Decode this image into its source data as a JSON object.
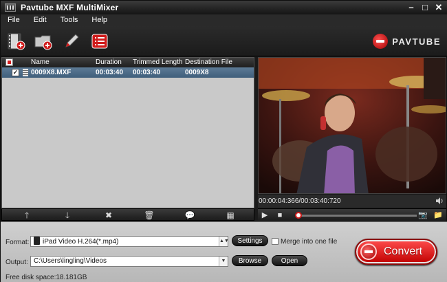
{
  "window": {
    "title": "Pavtube MXF MultiMixer"
  },
  "menu": [
    {
      "label": "File"
    },
    {
      "label": "Edit"
    },
    {
      "label": "Tools"
    },
    {
      "label": "Help"
    }
  ],
  "brand": {
    "logo_text": "PAVTUBE",
    "accent": "#d01b1b"
  },
  "toolbar_icons": [
    "add-video-icon",
    "add-folder-icon",
    "edit-pencil-icon",
    "task-list-icon"
  ],
  "file_list": {
    "columns": {
      "name": "Name",
      "duration": "Duration",
      "trimmed": "Trimmed Length",
      "destination": "Destination File"
    },
    "rows": [
      {
        "checked": true,
        "name": "0009X8.MXF",
        "duration": "00:03:40",
        "trimmed": "00:03:40",
        "destination": "0009X8"
      }
    ]
  },
  "list_tools": [
    "move-up-icon",
    "move-down-icon",
    "remove-icon",
    "delete-all-icon",
    "subtitle-icon",
    "merge-icon"
  ],
  "preview": {
    "time": "00:00:04:366/00:03:40:720",
    "seek_fraction": 0.02
  },
  "output_settings": {
    "format_label": "Format:",
    "format_value": "iPad Video H.264(*.mp4)",
    "settings_button": "Settings",
    "merge_label": "Merge into one file",
    "merge_checked": false,
    "output_label": "Output:",
    "output_value": "C:\\Users\\lingling\\Videos",
    "browse_button": "Browse",
    "open_button": "Open",
    "free_space": "Free disk space:18.181GB",
    "convert_button": "Convert"
  }
}
